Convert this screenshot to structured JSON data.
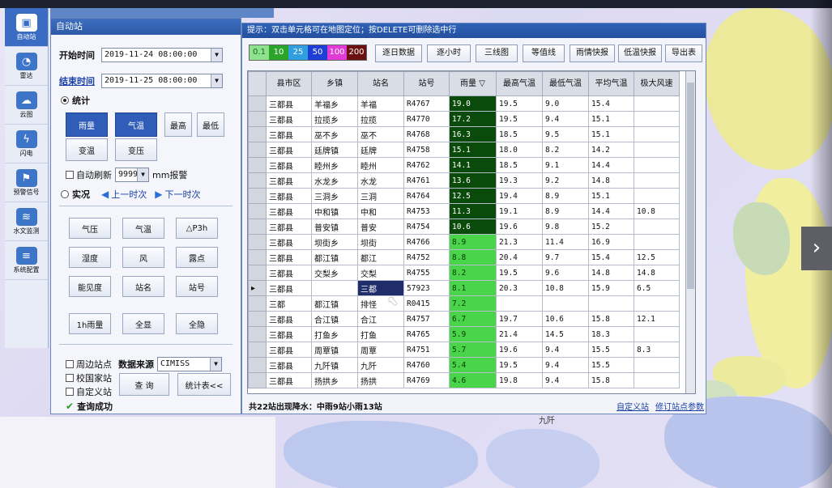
{
  "panel": {
    "title": "自动站",
    "start_label": "开始时间",
    "start_value": "2019-11-24 08:00:00",
    "end_label": "结束时间",
    "end_value": "2019-11-25 08:00:00",
    "stat_label": "统计",
    "stat_buttons": [
      "雨量",
      "气温",
      "最高",
      "最低",
      "变温",
      "变压"
    ],
    "auto_refresh_label": "自动刷新",
    "threshold_value": "9999",
    "threshold_unit": "mm报警",
    "realtime_label": "实况",
    "prev_label": "上一时次",
    "next_label": "下一时次",
    "element_buttons": [
      "气压",
      "气温",
      "△P3h",
      "湿度",
      "风",
      "露点",
      "能见度",
      "站名",
      "站号",
      "1h雨量",
      "全显",
      "全隐"
    ],
    "checkboxes": [
      "周边站点",
      "校国家站",
      "自定义站"
    ],
    "source_label": "数据来源",
    "source_value": "CIMISS",
    "query_button": "查 询",
    "stats_button": "统计表<<",
    "query_status": "查询成功"
  },
  "nav": [
    "自动站",
    "雷达",
    "云图",
    "闪电",
    "预警信号",
    "水文监测",
    "系统配置"
  ],
  "window": {
    "hint": "提示：双击单元格可在地图定位；按DELETE可删除选中行",
    "legend": [
      {
        "label": "0.1",
        "bg": "#8fe08f",
        "fg": "#1a6a1a"
      },
      {
        "label": "10",
        "bg": "#2aa52a",
        "fg": "#ffffff"
      },
      {
        "label": "25",
        "bg": "#2f9fe0",
        "fg": "#ffffff"
      },
      {
        "label": "50",
        "bg": "#1d3fd6",
        "fg": "#ffffff"
      },
      {
        "label": "100",
        "bg": "#e23ad6",
        "fg": "#ffffff"
      },
      {
        "label": "200",
        "bg": "#6a1010",
        "fg": "#ffffff"
      }
    ],
    "tools": [
      "逐日数据",
      "逐小时",
      "三线图",
      "等值线",
      "雨情快报",
      "低温快报",
      "导出表"
    ],
    "columns": [
      "县市区",
      "乡镇",
      "站名",
      "站号",
      "雨量",
      "最高气温",
      "最低气温",
      "平均气温",
      "极大风速"
    ],
    "rows": [
      [
        "三都县",
        "羊福乡",
        "羊福",
        "R4767",
        "19.0",
        "19.5",
        "9.0",
        "15.4",
        ""
      ],
      [
        "三都县",
        "拉揽乡",
        "拉揽",
        "R4770",
        "17.2",
        "19.5",
        "9.4",
        "15.1",
        ""
      ],
      [
        "三都县",
        "巫不乡",
        "巫不",
        "R4768",
        "16.3",
        "18.5",
        "9.5",
        "15.1",
        ""
      ],
      [
        "三都县",
        "廷牌镇",
        "廷牌",
        "R4758",
        "15.1",
        "18.0",
        "8.2",
        "14.2",
        ""
      ],
      [
        "三都县",
        "睦州乡",
        "睦州",
        "R4762",
        "14.1",
        "18.5",
        "9.1",
        "14.4",
        ""
      ],
      [
        "三都县",
        "水龙乡",
        "水龙",
        "R4761",
        "13.6",
        "19.3",
        "9.2",
        "14.8",
        ""
      ],
      [
        "三都县",
        "三洞乡",
        "三洞",
        "R4764",
        "12.5",
        "19.4",
        "8.9",
        "15.1",
        ""
      ],
      [
        "三都县",
        "中和镇",
        "中和",
        "R4753",
        "11.3",
        "19.1",
        "8.9",
        "14.4",
        "10.8"
      ],
      [
        "三都县",
        "普安镇",
        "普安",
        "R4754",
        "10.6",
        "19.6",
        "9.8",
        "15.2",
        ""
      ],
      [
        "三都县",
        "坝街乡",
        "坝街",
        "R4766",
        "8.9",
        "21.3",
        "11.4",
        "16.9",
        ""
      ],
      [
        "三都县",
        "都江镇",
        "都江",
        "R4752",
        "8.8",
        "20.4",
        "9.7",
        "15.4",
        "12.5"
      ],
      [
        "三都县",
        "交梨乡",
        "交梨",
        "R4755",
        "8.2",
        "19.5",
        "9.6",
        "14.8",
        "14.8"
      ],
      [
        "三都县",
        "",
        "三都",
        "57923",
        "8.1",
        "20.3",
        "10.8",
        "15.9",
        "6.5"
      ],
      [
        "三都",
        "都江镇",
        "排怪",
        "R0415",
        "7.2",
        "",
        "",
        "",
        ""
      ],
      [
        "三都县",
        "合江镇",
        "合江",
        "R4757",
        "6.7",
        "19.7",
        "10.6",
        "15.8",
        "12.1"
      ],
      [
        "三都县",
        "打鱼乡",
        "打鱼",
        "R4765",
        "5.9",
        "21.4",
        "14.5",
        "18.3",
        ""
      ],
      [
        "三都县",
        "周覃镇",
        "周覃",
        "R4751",
        "5.7",
        "19.6",
        "9.4",
        "15.5",
        "8.3"
      ],
      [
        "三都县",
        "九阡镇",
        "九阡",
        "R4760",
        "5.4",
        "19.5",
        "9.4",
        "15.5",
        ""
      ],
      [
        "三都县",
        "扬拱乡",
        "扬拱",
        "R4769",
        "4.6",
        "19.8",
        "9.4",
        "15.8",
        ""
      ]
    ],
    "status": "共22站出现降水：中雨9站小雨13站",
    "link_custom": "自定义站",
    "link_params": "修订站点参数"
  },
  "map": {
    "label": "九阡"
  },
  "colors": {
    "rain_heavy": "#0a4a0a",
    "rain_light": "#49d449",
    "header": "#d9dde6"
  }
}
